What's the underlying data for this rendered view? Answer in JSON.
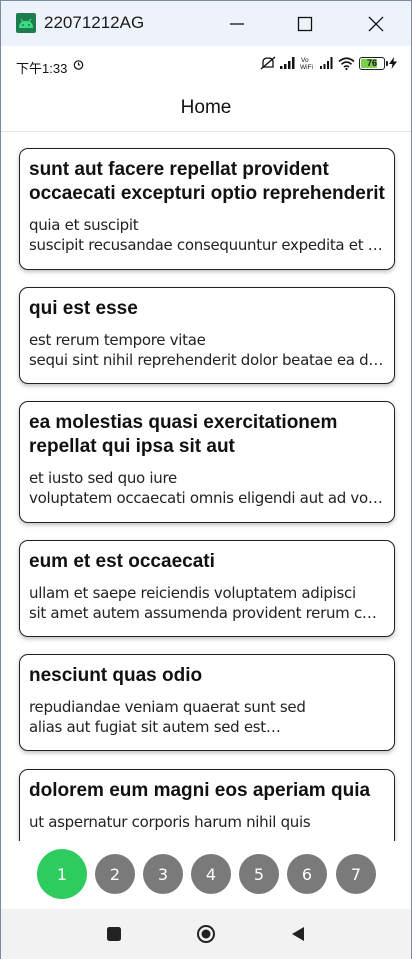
{
  "window": {
    "title": "22071212AG"
  },
  "status_bar": {
    "time": "下午1:33",
    "battery_level": "76",
    "battery_fraction": 0.76,
    "charging": true,
    "icons": [
      "alarm-icon",
      "mute-icon",
      "signal-icon",
      "signal-icon",
      "vowifi-icon",
      "signal-icon",
      "wifi-icon",
      "battery-icon",
      "bolt-icon"
    ],
    "vowifi_label": "Vo\nWiFi"
  },
  "app_bar": {
    "title": "Home"
  },
  "posts": [
    {
      "title": "sunt aut facere repellat provident occaecati excepturi optio reprehenderit",
      "line1": "quia et suscipit",
      "line2": "suscipit recusandae consequuntur expedita et cum"
    },
    {
      "title": "qui est esse",
      "line1": "est rerum tempore vitae",
      "line2": "sequi sint nihil reprehenderit dolor beatae ea dolores"
    },
    {
      "title": "ea molestias quasi exercitationem repellat qui ipsa sit aut",
      "line1": "et iusto sed quo iure",
      "line2": "voluptatem occaecati omnis eligendi aut ad voluptatem"
    },
    {
      "title": "eum et est occaecati",
      "line1": "ullam et saepe reiciendis voluptatem adipisci",
      "line2": "sit amet autem assumenda provident rerum culpa"
    },
    {
      "title": "nesciunt quas odio",
      "line1": "repudiandae veniam quaerat sunt sed",
      "line2": "alias aut fugiat sit autem sed est…"
    },
    {
      "title": "dolorem eum magni eos aperiam quia",
      "line1": "ut aspernatur corporis harum nihil quis",
      "line2": ""
    }
  ],
  "pagination": {
    "pages": [
      "1",
      "2",
      "3",
      "4",
      "5",
      "6",
      "7"
    ],
    "active": "1",
    "active_color": "#2ecc5e",
    "inactive_color": "#7a7a7a"
  },
  "nav_bar": {
    "buttons": [
      "recents-icon",
      "home-icon",
      "back-icon"
    ]
  }
}
